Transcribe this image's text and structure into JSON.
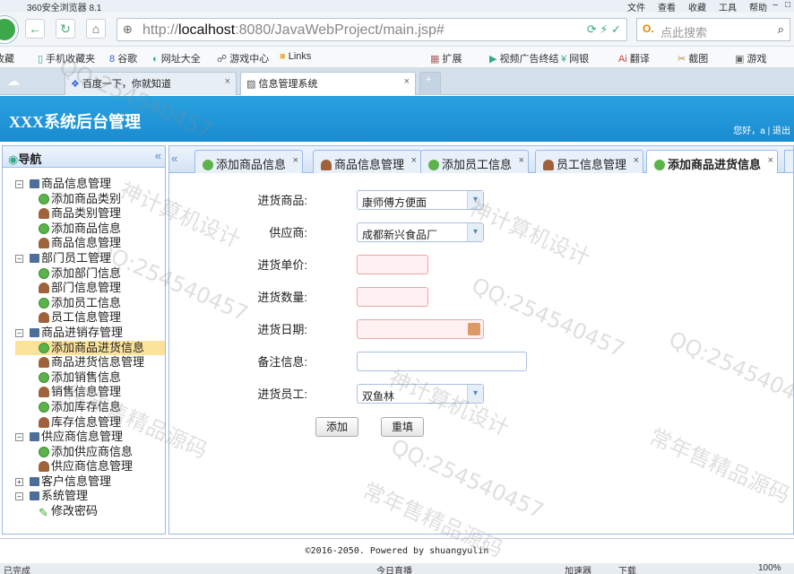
{
  "browser": {
    "title": "360安全浏览器 8.1",
    "menus": [
      "文件",
      "查看",
      "收藏",
      "工具",
      "帮助"
    ],
    "url_prefix": "http://",
    "url_host": "localhost",
    "url_rest": ":8080/JavaWebProject/main.jsp#",
    "search_placeholder": "点此搜索",
    "favorites": [
      "收藏",
      "手机收藏夹",
      "谷歌",
      "网址大全",
      "游戏中心",
      "Links"
    ],
    "extras": [
      "扩展",
      "视频广告终结",
      "网银",
      "翻译",
      "截图",
      "游戏"
    ],
    "tabs": [
      {
        "label": "百度一下，你就知道"
      },
      {
        "label": "信息管理系统"
      }
    ]
  },
  "app": {
    "header_title": "XXX系统后台管理",
    "welcome": "您好，a | 退出",
    "nav_title": "导航",
    "footer": "©2016-2050. Powered by shuangyulin"
  },
  "tree": [
    {
      "label": "商品信息管理",
      "children": [
        {
          "label": "添加商品类别",
          "icon": "plus"
        },
        {
          "label": "商品类别管理",
          "icon": "user"
        },
        {
          "label": "添加商品信息",
          "icon": "plus"
        },
        {
          "label": "商品信息管理",
          "icon": "user"
        }
      ]
    },
    {
      "label": "部门员工管理",
      "children": [
        {
          "label": "添加部门信息",
          "icon": "plus"
        },
        {
          "label": "部门信息管理",
          "icon": "user"
        },
        {
          "label": "添加员工信息",
          "icon": "plus"
        },
        {
          "label": "员工信息管理",
          "icon": "user"
        }
      ]
    },
    {
      "label": "商品进销存管理",
      "children": [
        {
          "label": "添加商品进货信息",
          "icon": "plus",
          "selected": true
        },
        {
          "label": "商品进货信息管理",
          "icon": "user"
        },
        {
          "label": "添加销售信息",
          "icon": "plus"
        },
        {
          "label": "销售信息管理",
          "icon": "user"
        },
        {
          "label": "添加库存信息",
          "icon": "plus"
        },
        {
          "label": "库存信息管理",
          "icon": "user"
        }
      ]
    },
    {
      "label": "供应商信息管理",
      "children": [
        {
          "label": "添加供应商信息",
          "icon": "plus"
        },
        {
          "label": "供应商信息管理",
          "icon": "user"
        }
      ]
    },
    {
      "label": "客户信息管理",
      "collapsed": true,
      "children": []
    },
    {
      "label": "系统管理",
      "children": [
        {
          "label": "修改密码",
          "icon": "pen"
        }
      ]
    }
  ],
  "content_tabs": [
    {
      "label": "添加商品信息",
      "icon": "plus"
    },
    {
      "label": "商品信息管理",
      "icon": "user"
    },
    {
      "label": "添加员工信息",
      "icon": "plus"
    },
    {
      "label": "员工信息管理",
      "icon": "user"
    },
    {
      "label": "添加商品进货信息",
      "icon": "plus",
      "active": true
    }
  ],
  "form": {
    "product_label": "进货商品:",
    "product_value": "康师傅方便面",
    "supplier_label": "供应商:",
    "supplier_value": "成都新兴食品厂",
    "price_label": "进货单价:",
    "price_value": "",
    "qty_label": "进货数量:",
    "qty_value": "",
    "date_label": "进货日期:",
    "date_value": "",
    "memo_label": "备注信息:",
    "memo_value": "",
    "employee_label": "进货员工:",
    "employee_value": "双鱼林",
    "add_button": "添加",
    "reset_button": "重填"
  },
  "status": {
    "left": "已完成",
    "right": [
      "今日直播",
      "加速器",
      "下载",
      "100%"
    ]
  },
  "watermarks": [
    "QQ:254540457",
    "神计算机设计",
    "常年售精品源码"
  ]
}
